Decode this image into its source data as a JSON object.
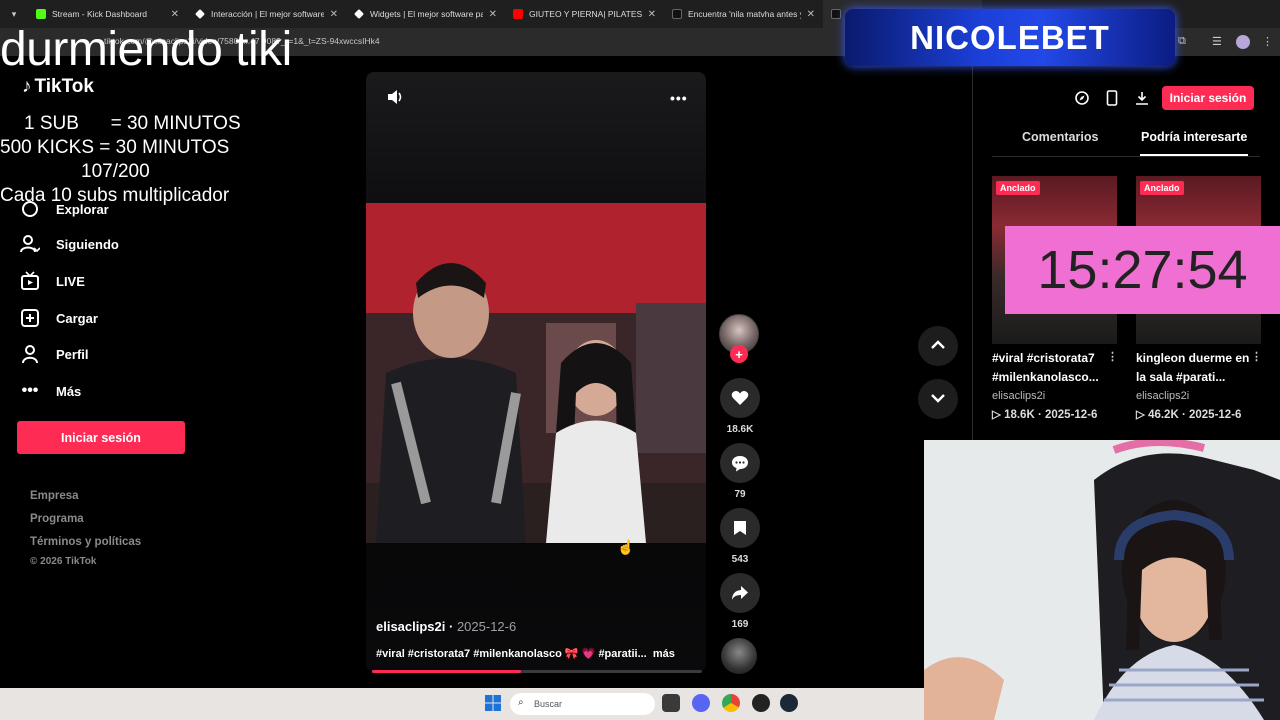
{
  "browser": {
    "tabs": [
      {
        "title": "Stream - Kick Dashboard",
        "color": "#53fc18"
      },
      {
        "title": "Interacción | El mejor software p",
        "color": "#ffffff"
      },
      {
        "title": "Widgets | El mejor software pa",
        "color": "#ffffff"
      },
      {
        "title": "GIUTEO Y PIERNA| PILATES CON",
        "color": "#ff0000"
      },
      {
        "title": "Encuentra 'nila matvha antes y",
        "color": "#ffffff"
      },
      {
        "title": "M",
        "color": "#ffffff"
      }
    ],
    "url": "tiktok.com/@elisaclips2i/video/75800...47  908?_r=1&_t=ZS-94xwccsIHk4"
  },
  "overlay": {
    "title": "durmiendo tiki",
    "rules": [
      "1 SUB      = 30 MINUTOS",
      "500 KICKS = 30 MINUTOS",
      "107/200",
      "Cada 10 subs multiplicador"
    ],
    "sponsor": "NICOLEBET",
    "timer": "15:27:54"
  },
  "tiktok": {
    "logo": "TikTok",
    "sidebar": [
      {
        "label": "Explorar",
        "icon": "compass-icon"
      },
      {
        "label": "Siguiendo",
        "icon": "following-icon"
      },
      {
        "label": "LIVE",
        "icon": "live-icon"
      },
      {
        "label": "Cargar",
        "icon": "upload-icon"
      },
      {
        "label": "Perfil",
        "icon": "profile-icon"
      },
      {
        "label": "Más",
        "icon": "more-icon"
      }
    ],
    "login": "Iniciar sesión",
    "footer": [
      "Empresa",
      "Programa",
      "Términos y políticas",
      "© 2026 TikTok"
    ],
    "video": {
      "author": "elisaclips2i",
      "date": "2025-12-6",
      "caption": "#viral #cristorata7 #milenkanolasco 🎀 💗 #paratii...",
      "more": "más",
      "progress": 0.45,
      "likes": "18.6K",
      "comments": "79",
      "saves": "543",
      "shares": "169"
    },
    "panel": {
      "login": "Iniciar sesión",
      "tabs": [
        "Comentarios",
        "Podría interesarte"
      ],
      "recs": [
        {
          "badge": "Anclado",
          "title": "#viral #cristorata7 #milenkanolasco...",
          "user": "elisaclips2i",
          "views": "18.6K",
          "date": "2025-12-6"
        },
        {
          "badge": "Anclado",
          "title": "kingleon duerme en la sala #parati...",
          "user": "elisaclips2i",
          "views": "46.2K",
          "date": "2025-12-6"
        }
      ]
    }
  },
  "taskbar": {
    "search_placeholder": "Buscar"
  }
}
